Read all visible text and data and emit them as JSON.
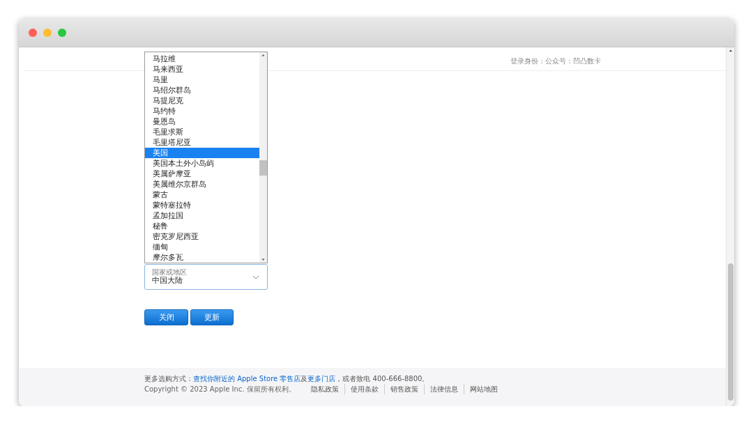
{
  "header": {
    "signed_in": "登录身份：公众号：凹凸数卡"
  },
  "country_list": {
    "items": [
      {
        "label": "马拉维",
        "selected": false
      },
      {
        "label": "马来西亚",
        "selected": false
      },
      {
        "label": "马里",
        "selected": false
      },
      {
        "label": "马绍尔群岛",
        "selected": false
      },
      {
        "label": "马提尼克",
        "selected": false
      },
      {
        "label": "马约特",
        "selected": false
      },
      {
        "label": "曼恩岛",
        "selected": false
      },
      {
        "label": "毛里求斯",
        "selected": false
      },
      {
        "label": "毛里塔尼亚",
        "selected": false
      },
      {
        "label": "美国",
        "selected": true
      },
      {
        "label": "美国本土外小岛屿",
        "selected": false
      },
      {
        "label": "美属萨摩亚",
        "selected": false
      },
      {
        "label": "美属维尔京群岛",
        "selected": false
      },
      {
        "label": "蒙古",
        "selected": false
      },
      {
        "label": "蒙特塞拉特",
        "selected": false
      },
      {
        "label": "孟加拉国",
        "selected": false
      },
      {
        "label": "秘鲁",
        "selected": false
      },
      {
        "label": "密克罗尼西亚",
        "selected": false
      },
      {
        "label": "缅甸",
        "selected": false
      },
      {
        "label": "摩尔多瓦",
        "selected": false
      }
    ]
  },
  "country_field": {
    "label": "国家或地区",
    "value": "中国大陆"
  },
  "buttons": [
    "关闭",
    "更新"
  ],
  "footer": {
    "line": [
      {
        "kind": "text",
        "text": "更多选购方式："
      },
      {
        "kind": "link",
        "text": "查找你附近的 Apple Store 零售店"
      },
      {
        "kind": "text",
        "text": "及"
      },
      {
        "kind": "link",
        "text": "更多门店"
      },
      {
        "kind": "text",
        "text": "，或者致电 400-666-8800。"
      }
    ],
    "copyright": "Copyright © 2023 Apple Inc. 保留所有权利。",
    "links": [
      "隐私政策",
      "使用条款",
      "销售政策",
      "法律信息",
      "网站地图"
    ]
  }
}
